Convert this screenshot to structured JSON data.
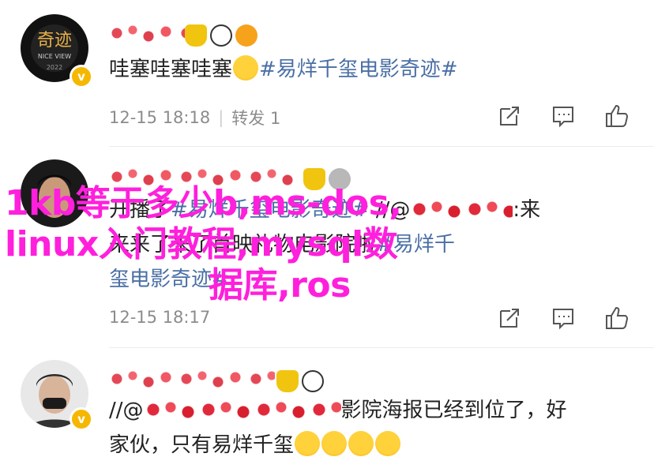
{
  "posts": [
    {
      "avatar_label": "奇迹",
      "avatar_sub": "NICE VIEW",
      "avatar_year": "2022",
      "text_parts": {
        "a": "哇塞哇塞哇塞",
        "tag": "#易烊千玺电影奇迹#"
      },
      "time": "12-15 18:18",
      "repost": "转发 1"
    },
    {
      "avatar_label": "",
      "text_parts": {
        "line1_a": "开播了",
        "line1_tag": "#易烊千玺电影奇迹#",
        "line1_b": " //@",
        "line1_c": ":来",
        "line2_a": "来来了来了",
        "line2_b": "首映礼物",
        "line2_c": "电影院啦",
        "line2_tag": "#易烊千",
        "line3_tag": "玺电影奇迹#"
      },
      "time": "12-15 18:17"
    },
    {
      "avatar_label": "",
      "text_parts": {
        "line1_a": "//@",
        "line1_b": "影院海报已经到位了，好",
        "line2_a": "家伙，只有易烊千玺"
      }
    }
  ],
  "overlay": {
    "line1": "1kb等于多少b,ms-dos,",
    "line2": "linux入门教程,mysql数",
    "line3": "据库,ros"
  },
  "colors": {
    "tag": "#4a6fa5",
    "overlay": "#ff1fdc",
    "verified": "#f6b700"
  },
  "icons": [
    "share-icon",
    "comment-icon",
    "like-icon"
  ]
}
